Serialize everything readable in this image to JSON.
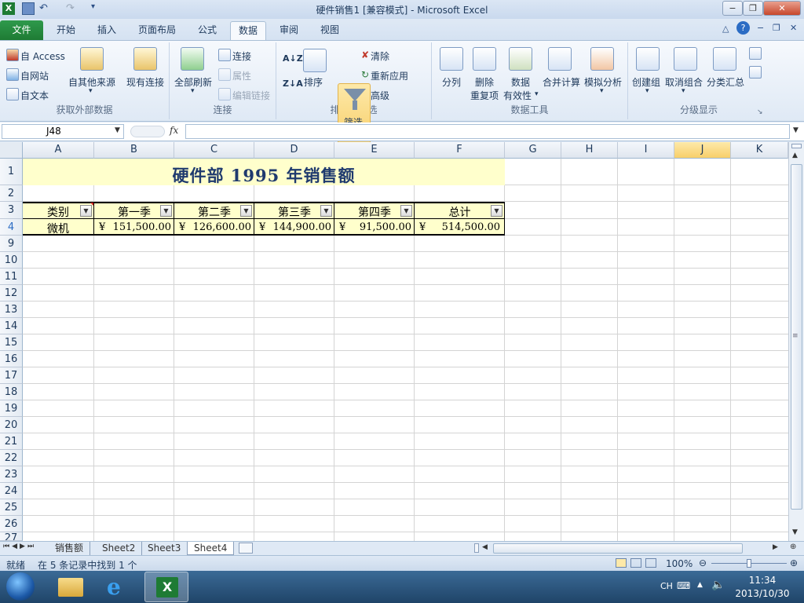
{
  "window": {
    "title": "硬件销售1 [兼容模式] - Microsoft Excel",
    "minimize": "−",
    "restore": "❐",
    "close": "✕"
  },
  "tabs": [
    "文件",
    "开始",
    "插入",
    "页面布局",
    "公式",
    "数据",
    "审阅",
    "视图"
  ],
  "ribbon": {
    "external": {
      "access": "自 Access",
      "web": "自网站",
      "text": "自文本",
      "other": "自其他来源",
      "existing": "现有连接",
      "label": "获取外部数据"
    },
    "connections": {
      "refresh": "全部刷新",
      "conn": "连接",
      "props": "属性",
      "editlinks": "编辑链接",
      "label": "连接"
    },
    "sortfilter": {
      "sort": "排序",
      "filter": "筛选",
      "clear": "清除",
      "reapply": "重新应用",
      "advanced": "高级",
      "label": "排序和筛选"
    },
    "datatools": {
      "split": "分列",
      "remove1": "删除",
      "remove2": "重复项",
      "valid1": "数据",
      "valid2": "有效性",
      "consolidate": "合并计算",
      "whatif": "模拟分析",
      "label": "数据工具"
    },
    "outline": {
      "group": "创建组",
      "ungroup": "取消组合",
      "subtotal": "分类汇总",
      "label": "分级显示"
    }
  },
  "formula_bar": {
    "name_box": "J48",
    "fx": "fx",
    "value": ""
  },
  "columns": [
    "A",
    "B",
    "C",
    "D",
    "E",
    "F",
    "G",
    "H",
    "I",
    "J",
    "K"
  ],
  "rows": [
    "1",
    "2",
    "3",
    "4",
    "9",
    "10",
    "11",
    "12",
    "13",
    "14",
    "15",
    "16",
    "17",
    "18",
    "19",
    "20",
    "21",
    "22",
    "23",
    "24",
    "25",
    "26",
    "27"
  ],
  "sheet": {
    "title": "硬件部 1995 年销售额",
    "headers": [
      "类别",
      "第一季",
      "第二季",
      "第三季",
      "第四季",
      "总计"
    ],
    "record": {
      "category": "微机",
      "currency": "¥",
      "values": [
        "151,500.00",
        "126,600.00",
        "144,900.00",
        "91,500.00",
        "514,500.00"
      ]
    }
  },
  "sheet_tabs": [
    "销售额",
    "Sheet2",
    "Sheet3",
    "Sheet4"
  ],
  "status": {
    "ready": "就绪",
    "message": "在 5 条记录中找到 1 个",
    "zoom": "100%"
  },
  "taskbar": {
    "lang": "CH",
    "time": "11:34",
    "date": "2013/10/30"
  }
}
